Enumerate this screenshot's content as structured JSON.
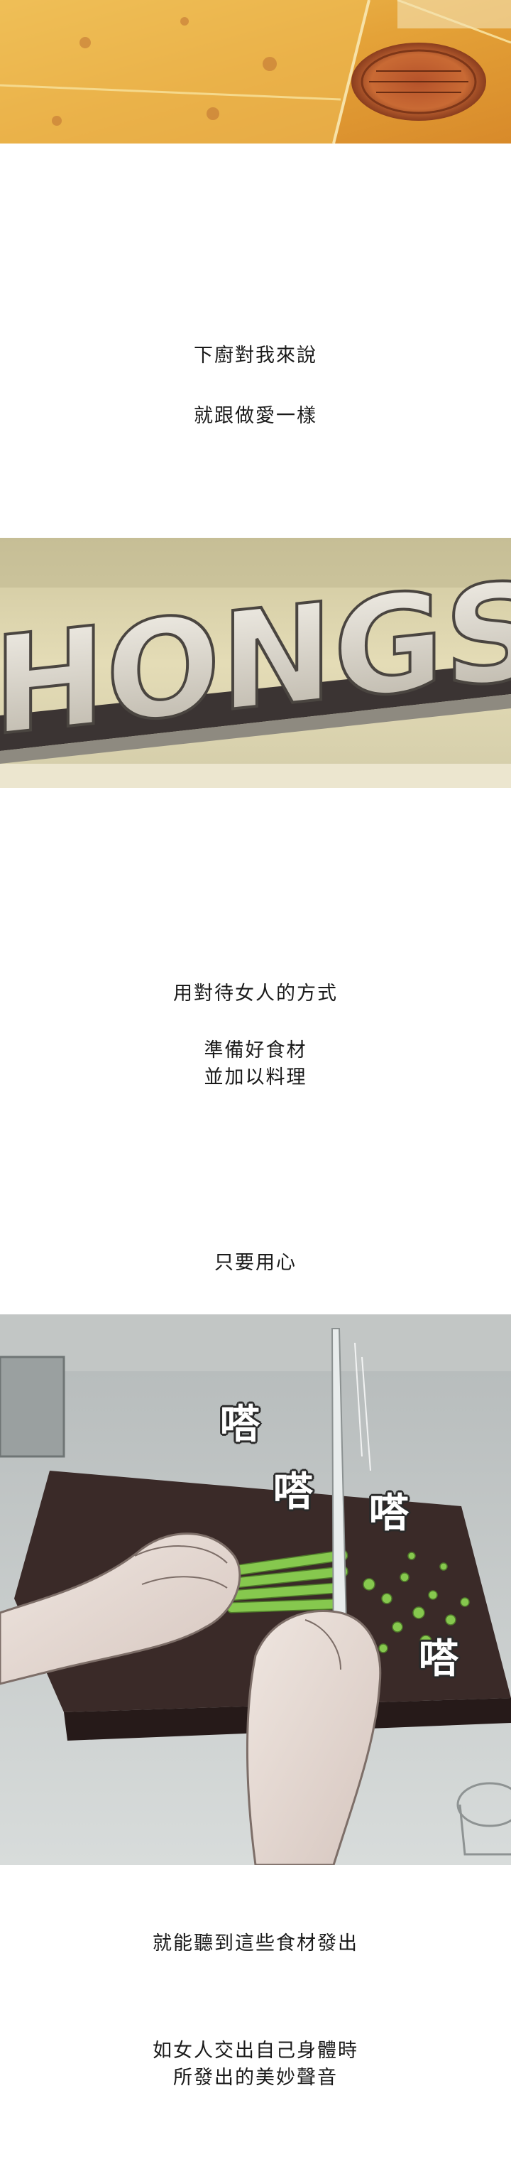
{
  "captions": {
    "c1": [
      "下廚對我來說"
    ],
    "c2": [
      "就跟做愛一樣"
    ],
    "c3": [
      "用對待女人的方式"
    ],
    "c4": [
      "準備好食材",
      "並加以料理"
    ],
    "c5": [
      "只要用心"
    ],
    "c6": [
      "就能聽到這些食材發出"
    ],
    "c7": [
      "如女人交出自己身體時",
      "所發出的美妙聲音"
    ]
  },
  "sign_text": "HONGS K",
  "sfx": [
    "嗒",
    "嗒",
    "嗒",
    "嗒"
  ],
  "colors": {
    "background": "#ffffff",
    "caption_text": "#1a1a1a",
    "floor_tile": "#e9a93c",
    "sign_bg": "#d9d2ad",
    "onion_green": "#7fc24a",
    "board": "#3a2a28"
  }
}
